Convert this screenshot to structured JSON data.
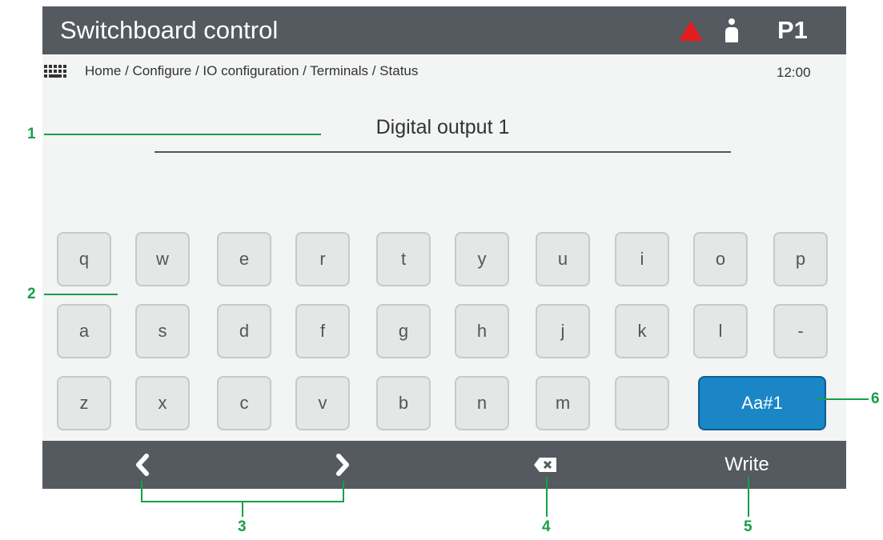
{
  "header": {
    "title": "Switchboard control",
    "password_level": "P1",
    "alarm_icon": "warning-triangle-icon",
    "user_icon": "user-icon",
    "colors": {
      "bar": "#545a60",
      "alarm": "#e31d1d"
    }
  },
  "breadcrumb": {
    "icon": "keyboard-icon",
    "path": "Home / Configure / IO configuration / Terminals / Status",
    "time": "12:00"
  },
  "field": {
    "value": "Digital output 1"
  },
  "keyboard": {
    "rows": [
      [
        "q",
        "w",
        "e",
        "r",
        "t",
        "y",
        "u",
        "i",
        "o",
        "p"
      ],
      [
        "a",
        "s",
        "d",
        "f",
        "g",
        "h",
        "j",
        "k",
        "l",
        "-"
      ],
      [
        "z",
        "x",
        "c",
        "v",
        "b",
        "n",
        "m",
        " "
      ]
    ],
    "mode_key": "Aa#1",
    "mode_color": "#1b86c6"
  },
  "navbar": {
    "left_icon": "chevron-left-icon",
    "right_icon": "chevron-right-icon",
    "backspace_icon": "backspace-icon",
    "write_label": "Write"
  },
  "callouts": [
    "1",
    "2",
    "3",
    "4",
    "5",
    "6"
  ],
  "callout_color": "#16a04a"
}
